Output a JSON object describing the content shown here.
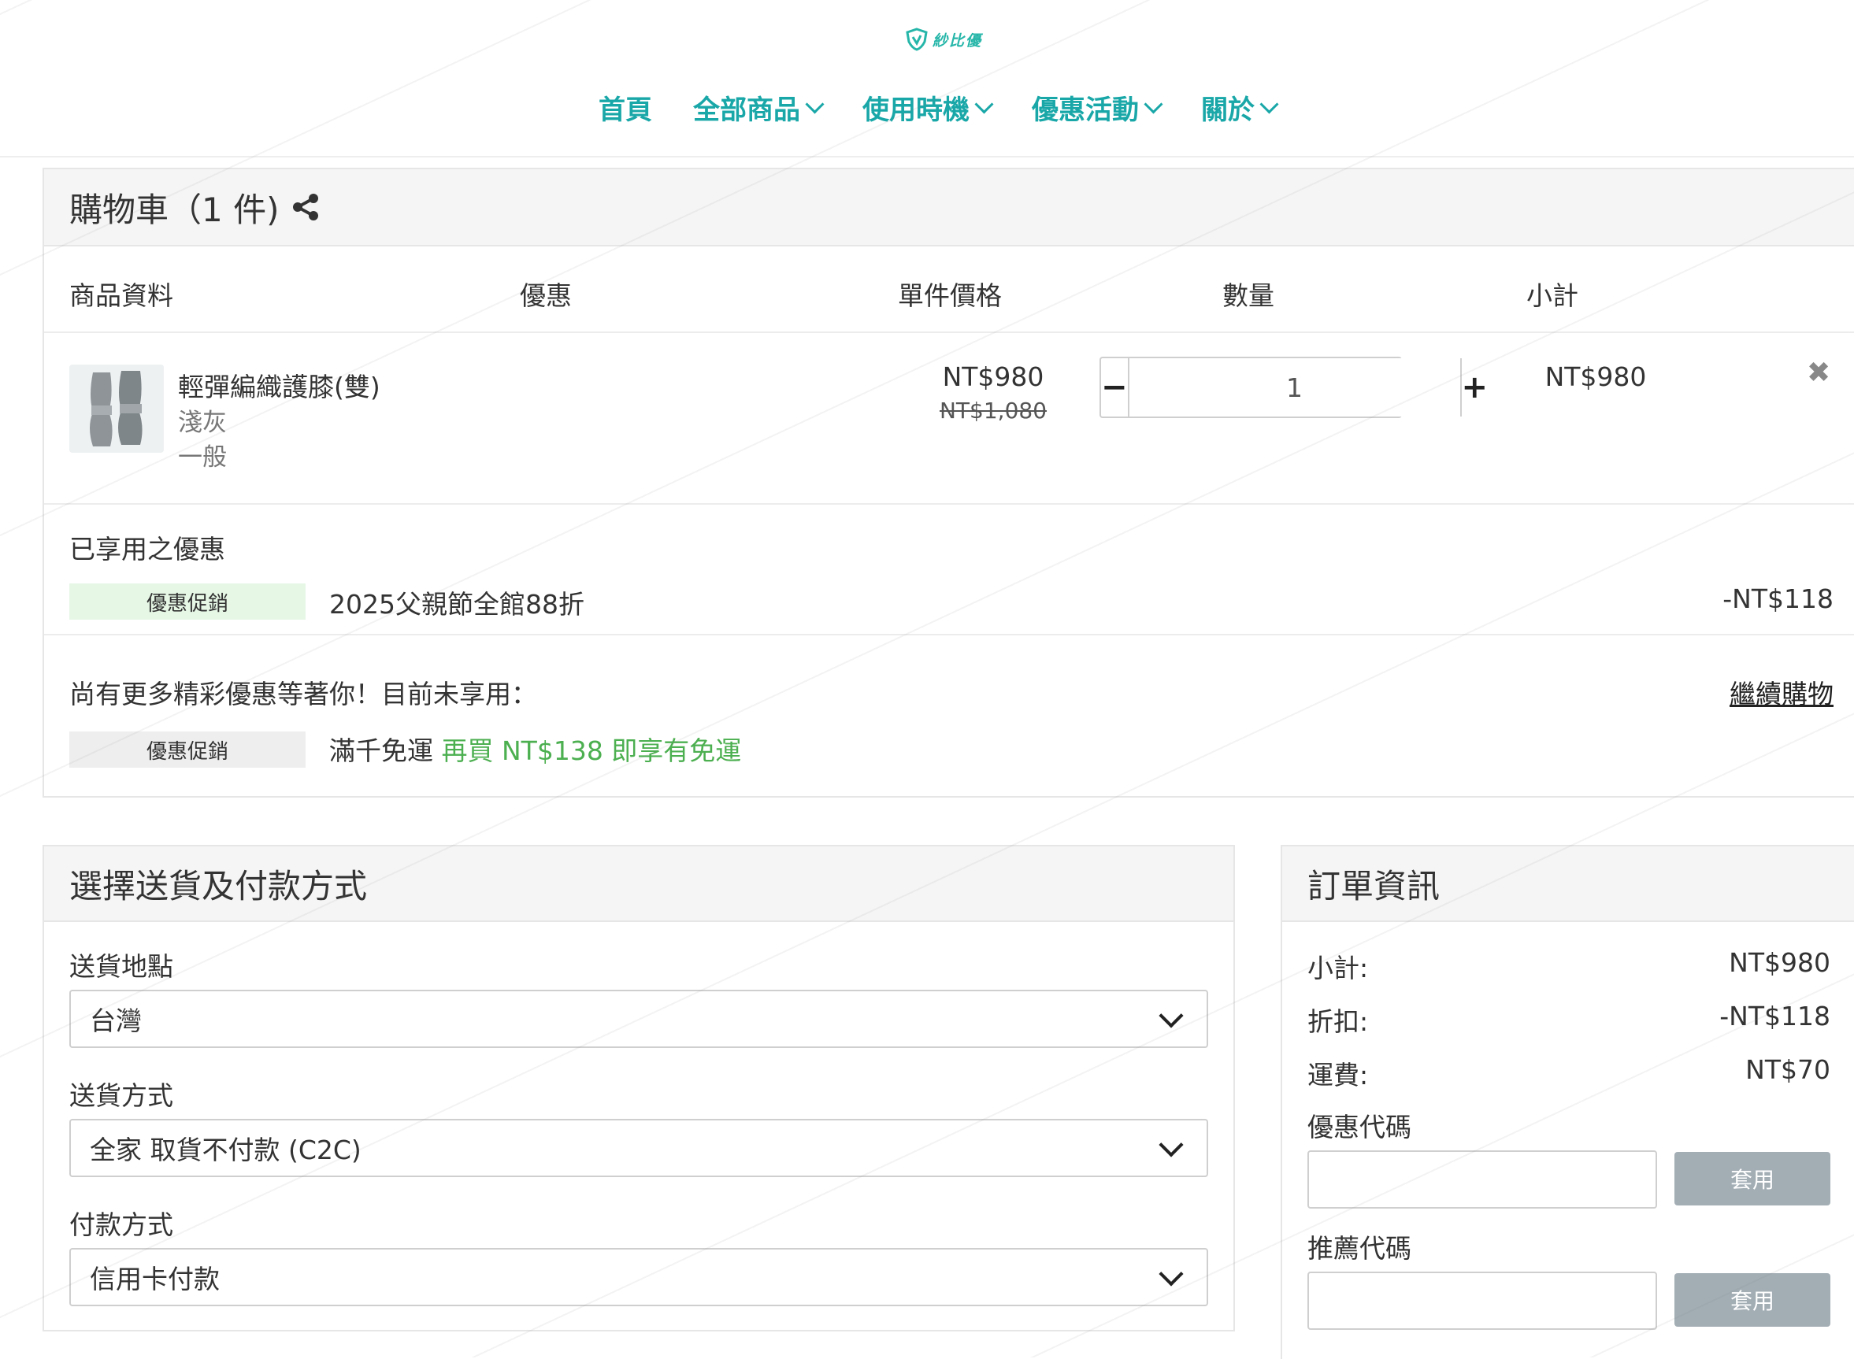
{
  "header": {
    "logo_text": "紗比優",
    "nav": [
      "首頁",
      "全部商品",
      "使用時機",
      "優惠活動",
      "關於"
    ]
  },
  "cart": {
    "title": "購物車（1 件)",
    "columns": {
      "product": "商品資料",
      "discount": "優惠",
      "unit_price": "單件價格",
      "quantity": "數量",
      "subtotal": "小計"
    },
    "item": {
      "name": "輕彈編織護膝(雙)",
      "variant_color": "淺灰",
      "variant_type": "一般",
      "price": "NT$980",
      "price_original": "NT$1,080",
      "quantity": "1",
      "subtotal": "NT$980"
    },
    "applied": {
      "label": "已享用之優惠",
      "badge": "優惠促銷",
      "name": "2025父親節全館88折",
      "amount": "-NT$118"
    },
    "more": {
      "label": "尚有更多精彩優惠等著你！目前未享用：",
      "continue": "繼續購物",
      "badge": "優惠促銷",
      "name": "滿千免運",
      "hint": "再買 NT$138 即享有免運"
    }
  },
  "shipping": {
    "title": "選擇送貨及付款方式",
    "destination_label": "送貨地點",
    "destination_value": "台灣",
    "method_label": "送貨方式",
    "method_value": "全家 取貨不付款 (C2C)",
    "payment_label": "付款方式",
    "payment_value": "信用卡付款"
  },
  "order": {
    "title": "訂單資訊",
    "subtotal_label": "小計:",
    "subtotal_value": "NT$980",
    "discount_label": "折扣:",
    "discount_value": "-NT$118",
    "shipping_label": "運費:",
    "shipping_value": "NT$70",
    "coupon_label": "優惠代碼",
    "coupon_apply": "套用",
    "referral_label": "推薦代碼",
    "referral_apply": "套用"
  },
  "colors": {
    "nav_accent": "#1aa7a8",
    "promo_green": "#4caf50",
    "apply_button": "#a2adb4"
  }
}
